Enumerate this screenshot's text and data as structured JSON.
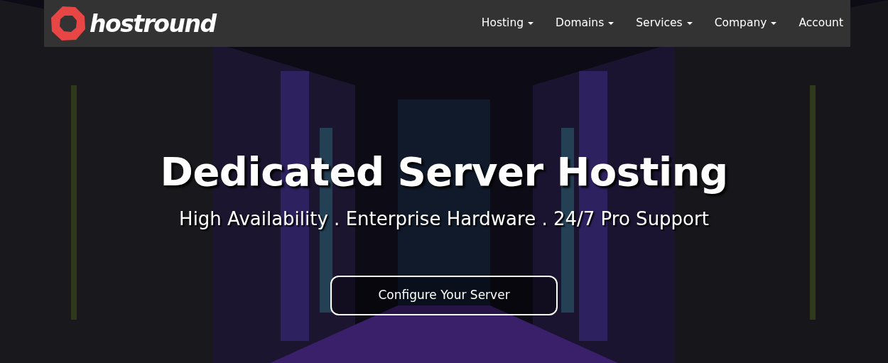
{
  "brand": {
    "name": "hostround"
  },
  "nav": [
    {
      "label": "Hosting",
      "dropdown": true
    },
    {
      "label": "Domains",
      "dropdown": true
    },
    {
      "label": "Services",
      "dropdown": true
    },
    {
      "label": "Company",
      "dropdown": true
    },
    {
      "label": "Account",
      "dropdown": false
    }
  ],
  "hero": {
    "kind": "picture",
    "title": "Dedicated Server Hosting",
    "subtitle": "High Availability . Enterprise Hardware . 24/7 Pro Support",
    "button": "Configure Your Server"
  }
}
